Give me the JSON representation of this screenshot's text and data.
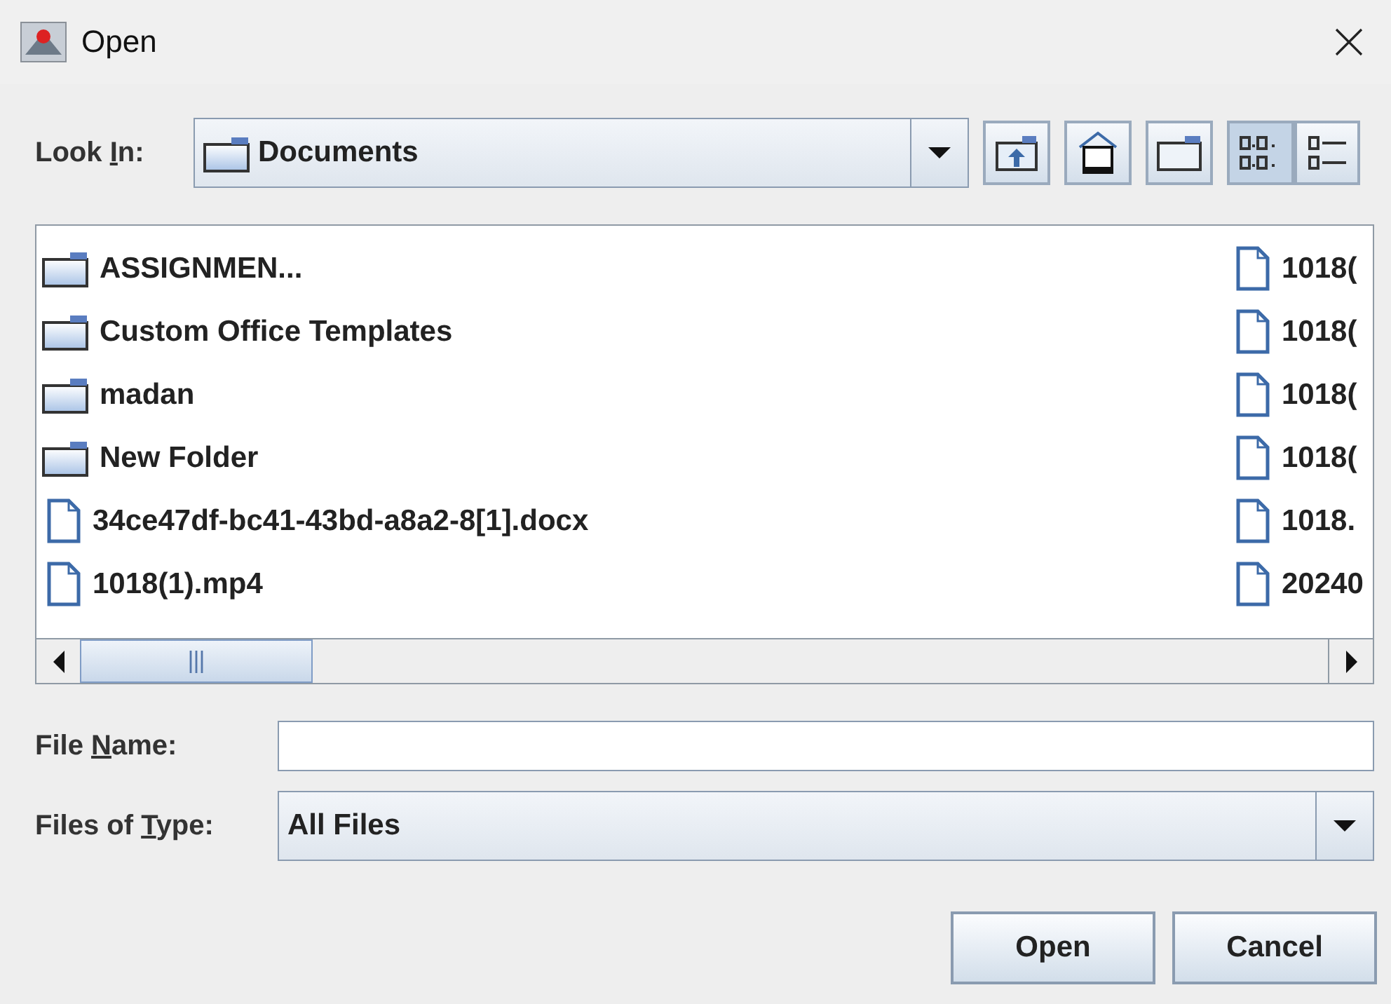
{
  "window": {
    "title": "Open"
  },
  "look_in": {
    "label": {
      "before": "Look ",
      "key": "I",
      "after": "n:"
    },
    "value": "Documents"
  },
  "toolbar": [
    {
      "kind": "up"
    },
    {
      "kind": "home"
    },
    {
      "kind": "new-folder"
    },
    {
      "kind": "list-view",
      "selected": true
    },
    {
      "kind": "details-view",
      "selected": false
    }
  ],
  "files": [
    {
      "name": "ASSIGNMEN...",
      "kind": "folder"
    },
    {
      "name": "Custom Office Templates",
      "kind": "folder"
    },
    {
      "name": "madan",
      "kind": "folder"
    },
    {
      "name": "New Folder",
      "kind": "folder"
    },
    {
      "name": "34ce47df-bc41-43bd-a8a2-8[1].docx",
      "kind": "file"
    },
    {
      "name": "1018(1).mp4",
      "kind": "file"
    },
    {
      "name": "1018(",
      "kind": "file"
    },
    {
      "name": "1018(",
      "kind": "file"
    },
    {
      "name": "1018(",
      "kind": "file"
    },
    {
      "name": "1018(",
      "kind": "file"
    },
    {
      "name": "1018.",
      "kind": "file"
    },
    {
      "name": "20240",
      "kind": "file"
    }
  ],
  "file_name": {
    "label": {
      "before": "File ",
      "key": "N",
      "after": "ame:"
    }
  },
  "file_type": {
    "label": {
      "before": "Files of ",
      "key": "T",
      "after": "ype:"
    },
    "value": "All Files"
  },
  "buttons": [
    "Open",
    "Cancel"
  ]
}
